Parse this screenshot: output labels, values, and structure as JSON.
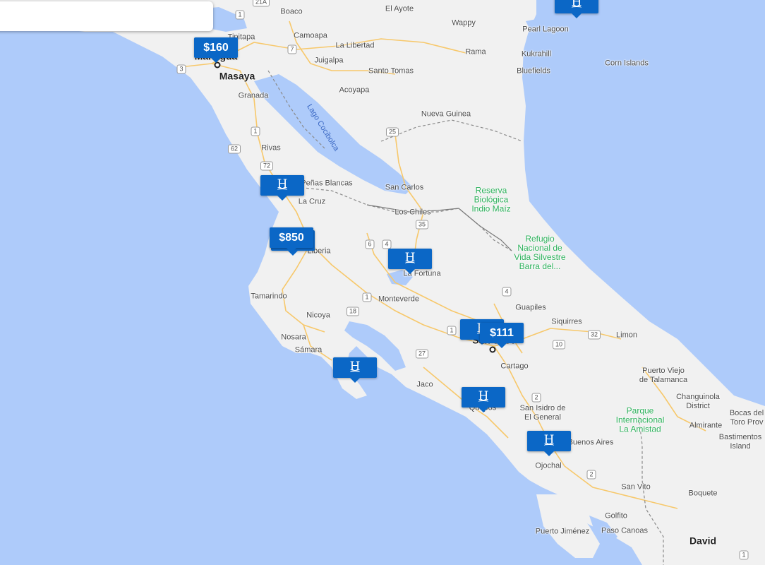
{
  "search": {
    "value": "",
    "placeholder": ""
  },
  "colors": {
    "water": "#aecbfa",
    "land": "#f1f1f1",
    "marker": "#0b67c6",
    "park_text": "#2bb05a"
  },
  "labels": {
    "managua": "Managua",
    "masaya": "Masaya",
    "granada": "Granada",
    "boaco": "Boaco",
    "el_ayote": "El Ayote",
    "wappy": "Wappy",
    "pearl_lagoon": "Pearl Lagoon",
    "kukrahill": "Kukrahill",
    "bluefields": "Bluefields",
    "corn_islands": "Corn Islands",
    "tipitapa": "Tipitapa",
    "camoapa": "Camoapa",
    "la_libertad": "La Libertad",
    "rama": "Rama",
    "juigalpa": "Juigalpa",
    "santo_tomas": "Santo Tomas",
    "acoyapa": "Acoyapa",
    "nueva_guinea": "Nueva Guinea",
    "lago_cocibolca": "Lago Cocibolca",
    "rivas": "Rivas",
    "penas_blancas": "Peñas Blancas",
    "san_carlos": "San Carlos",
    "reserva": "Reserva\nBiológica\nIndio Maíz",
    "la_cruz": "La Cruz",
    "los_chiles": "Los Chiles",
    "refugio": "Refugio\nNacional de\nVida Silvestre\nBarra del...",
    "liberia": "Liberia",
    "la_fortuna": "La Fortuna",
    "tamarindo": "Tamarindo",
    "monteverde": "Monteverde",
    "nicoya": "Nicoya",
    "guapiles": "Guapiles",
    "siquirres": "Siquirres",
    "limon": "Limon",
    "nosara": "Nosara",
    "samara": "Sámara",
    "san_jose": "San José",
    "cartago": "Cartago",
    "jaco": "Jaco",
    "puerto_viejo": "Puerto Viejo\nde Talamanca",
    "changuinola": "Changuinola\nDistrict",
    "quepos": "Quepos",
    "san_isidro": "San Isidro de\nEl General",
    "parque": "Parque\nInternacional\nLa Amistad",
    "almirante": "Almirante",
    "bocas": "Bocas del\nToro Prov",
    "bastimentos": "Bastimentos\nIsland",
    "buenos_aires": "Buenos Aires",
    "ojochal": "Ojochal",
    "san_vito": "San Vito",
    "boquete": "Boquete",
    "golfito": "Golfito",
    "puerto_jimenez": "Puerto Jiménez",
    "paso_canoas": "Paso Canoas",
    "david": "David"
  },
  "shields": [
    "21A",
    "1",
    "3",
    "7",
    "62",
    "72",
    "1",
    "25",
    "35",
    "6",
    "4",
    "1",
    "18",
    "4",
    "10",
    "32",
    "27",
    "1",
    "2",
    "2",
    "1"
  ],
  "markers": {
    "m160": "$160",
    "m850": "$850",
    "m111": "$111",
    "hotel": "H"
  }
}
